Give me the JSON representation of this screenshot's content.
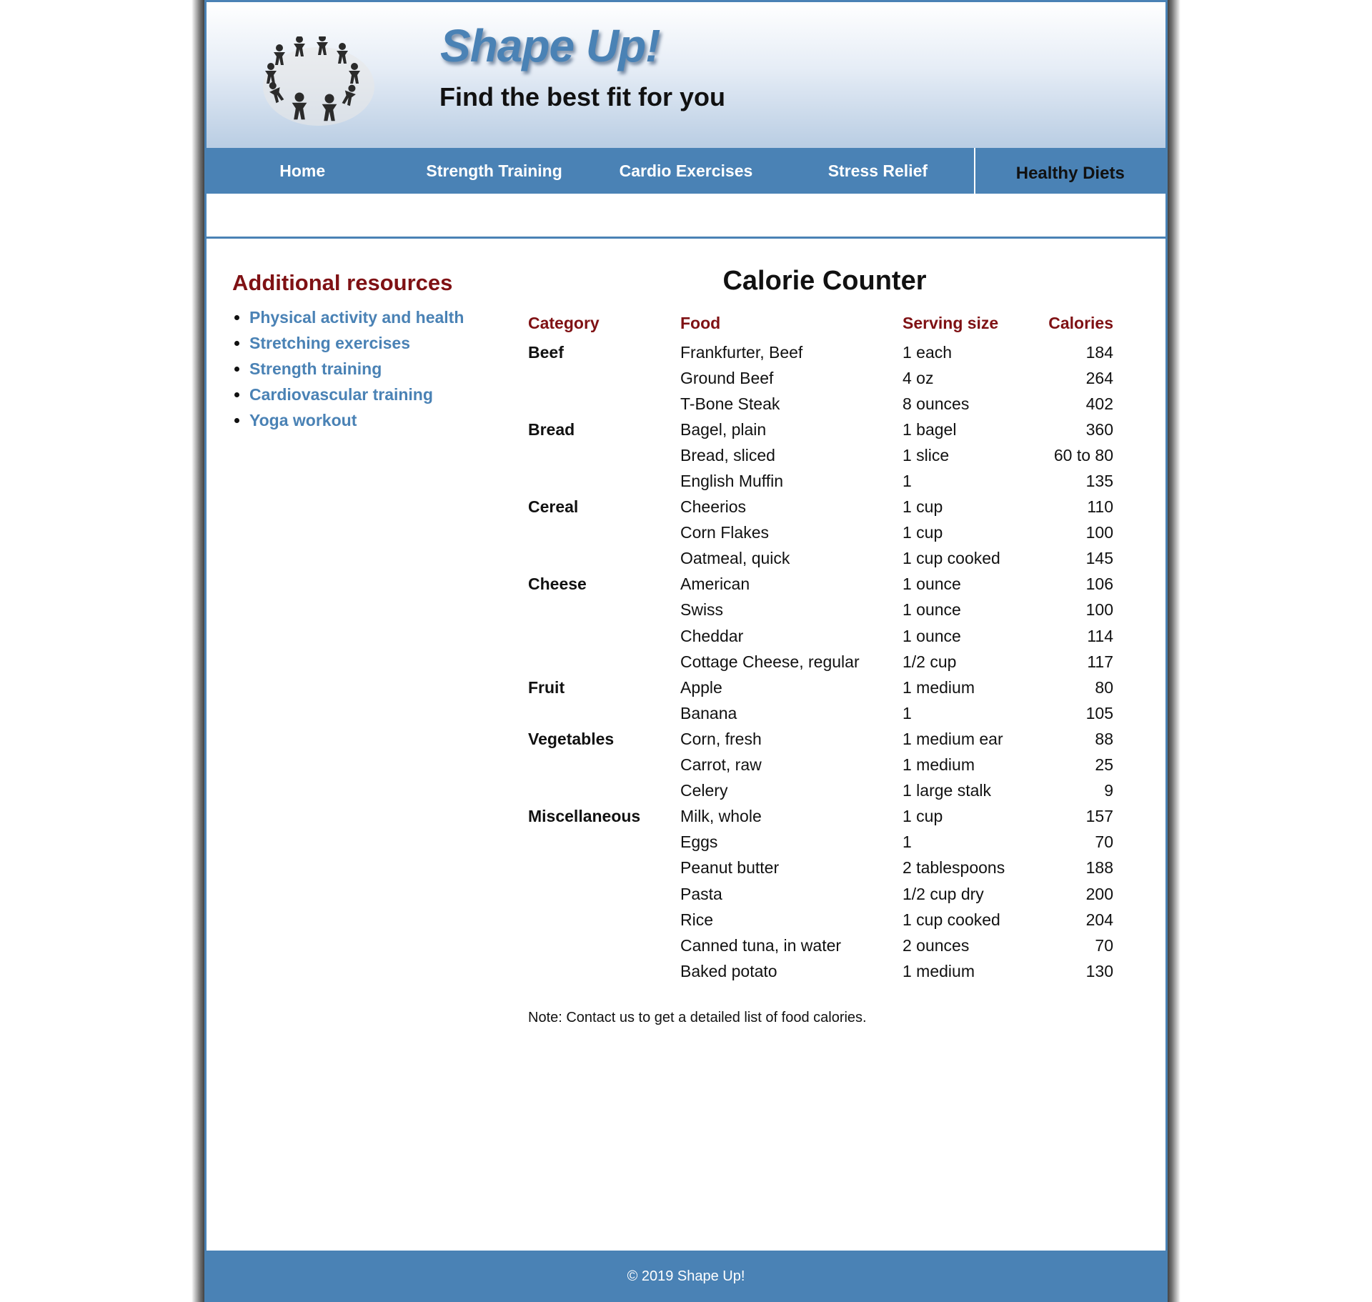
{
  "header": {
    "site_title": "Shape Up!",
    "tagline": "Find the best fit for you"
  },
  "nav": {
    "items": [
      {
        "label": "Home"
      },
      {
        "label": "Strength Training"
      },
      {
        "label": "Cardio Exercises"
      },
      {
        "label": "Stress Relief"
      },
      {
        "label": "Healthy Diets",
        "active": true
      }
    ]
  },
  "sidebar": {
    "title": "Additional resources",
    "links": [
      "Physical activity and health",
      "Stretching exercises",
      "Strength training",
      "Cardiovascular training",
      "Yoga workout"
    ]
  },
  "main": {
    "title": "Calorie Counter",
    "table": {
      "headers": [
        "Category",
        "Food",
        "Serving size",
        "Calories"
      ],
      "rows": [
        {
          "category": "Beef",
          "food": "Frankfurter, Beef",
          "serving": "1 each",
          "calories": "184"
        },
        {
          "category": "",
          "food": "Ground Beef",
          "serving": "4 oz",
          "calories": "264"
        },
        {
          "category": "",
          "food": "T-Bone Steak",
          "serving": "8 ounces",
          "calories": "402"
        },
        {
          "category": "Bread",
          "food": "Bagel, plain",
          "serving": "1 bagel",
          "calories": "360"
        },
        {
          "category": "",
          "food": "Bread, sliced",
          "serving": "1 slice",
          "calories": "60 to 80"
        },
        {
          "category": "",
          "food": "English Muffin",
          "serving": "1",
          "calories": "135"
        },
        {
          "category": "Cereal",
          "food": "Cheerios",
          "serving": "1 cup",
          "calories": "110"
        },
        {
          "category": "",
          "food": "Corn Flakes",
          "serving": "1 cup",
          "calories": "100"
        },
        {
          "category": "",
          "food": "Oatmeal, quick",
          "serving": "1 cup cooked",
          "calories": "145"
        },
        {
          "category": "Cheese",
          "food": "American",
          "serving": "1 ounce",
          "calories": "106"
        },
        {
          "category": "",
          "food": "Swiss",
          "serving": "1 ounce",
          "calories": "100"
        },
        {
          "category": "",
          "food": "Cheddar",
          "serving": "1 ounce",
          "calories": "114"
        },
        {
          "category": "",
          "food": "Cottage Cheese, regular",
          "serving": "1/2 cup",
          "calories": "117"
        },
        {
          "category": "Fruit",
          "food": "Apple",
          "serving": "1 medium",
          "calories": "80"
        },
        {
          "category": "",
          "food": "Banana",
          "serving": "1",
          "calories": "105"
        },
        {
          "category": "Vegetables",
          "food": "Corn, fresh",
          "serving": "1 medium ear",
          "calories": "88"
        },
        {
          "category": "",
          "food": "Carrot, raw",
          "serving": "1 medium",
          "calories": "25"
        },
        {
          "category": "",
          "food": "Celery",
          "serving": "1 large stalk",
          "calories": "9"
        },
        {
          "category": "Miscellaneous",
          "food": "Milk, whole",
          "serving": "1 cup",
          "calories": "157"
        },
        {
          "category": "",
          "food": "Eggs",
          "serving": "1",
          "calories": "70"
        },
        {
          "category": "",
          "food": "Peanut butter",
          "serving": "2 tablespoons",
          "calories": "188"
        },
        {
          "category": "",
          "food": "Pasta",
          "serving": "1/2 cup dry",
          "calories": "200"
        },
        {
          "category": "",
          "food": "Rice",
          "serving": "1 cup cooked",
          "calories": "204"
        },
        {
          "category": "",
          "food": "Canned tuna, in water",
          "serving": "2 ounces",
          "calories": "70"
        },
        {
          "category": "",
          "food": "Baked potato",
          "serving": "1 medium",
          "calories": "130"
        }
      ]
    },
    "note": "Note: Contact us to get a detailed list of food calories."
  },
  "footer": {
    "copyright": "© 2019 Shape Up!"
  },
  "colors": {
    "accent_blue": "#4a82b5",
    "heading_red": "#7f1114"
  },
  "icons": {
    "logo": "people-circle-logo"
  }
}
